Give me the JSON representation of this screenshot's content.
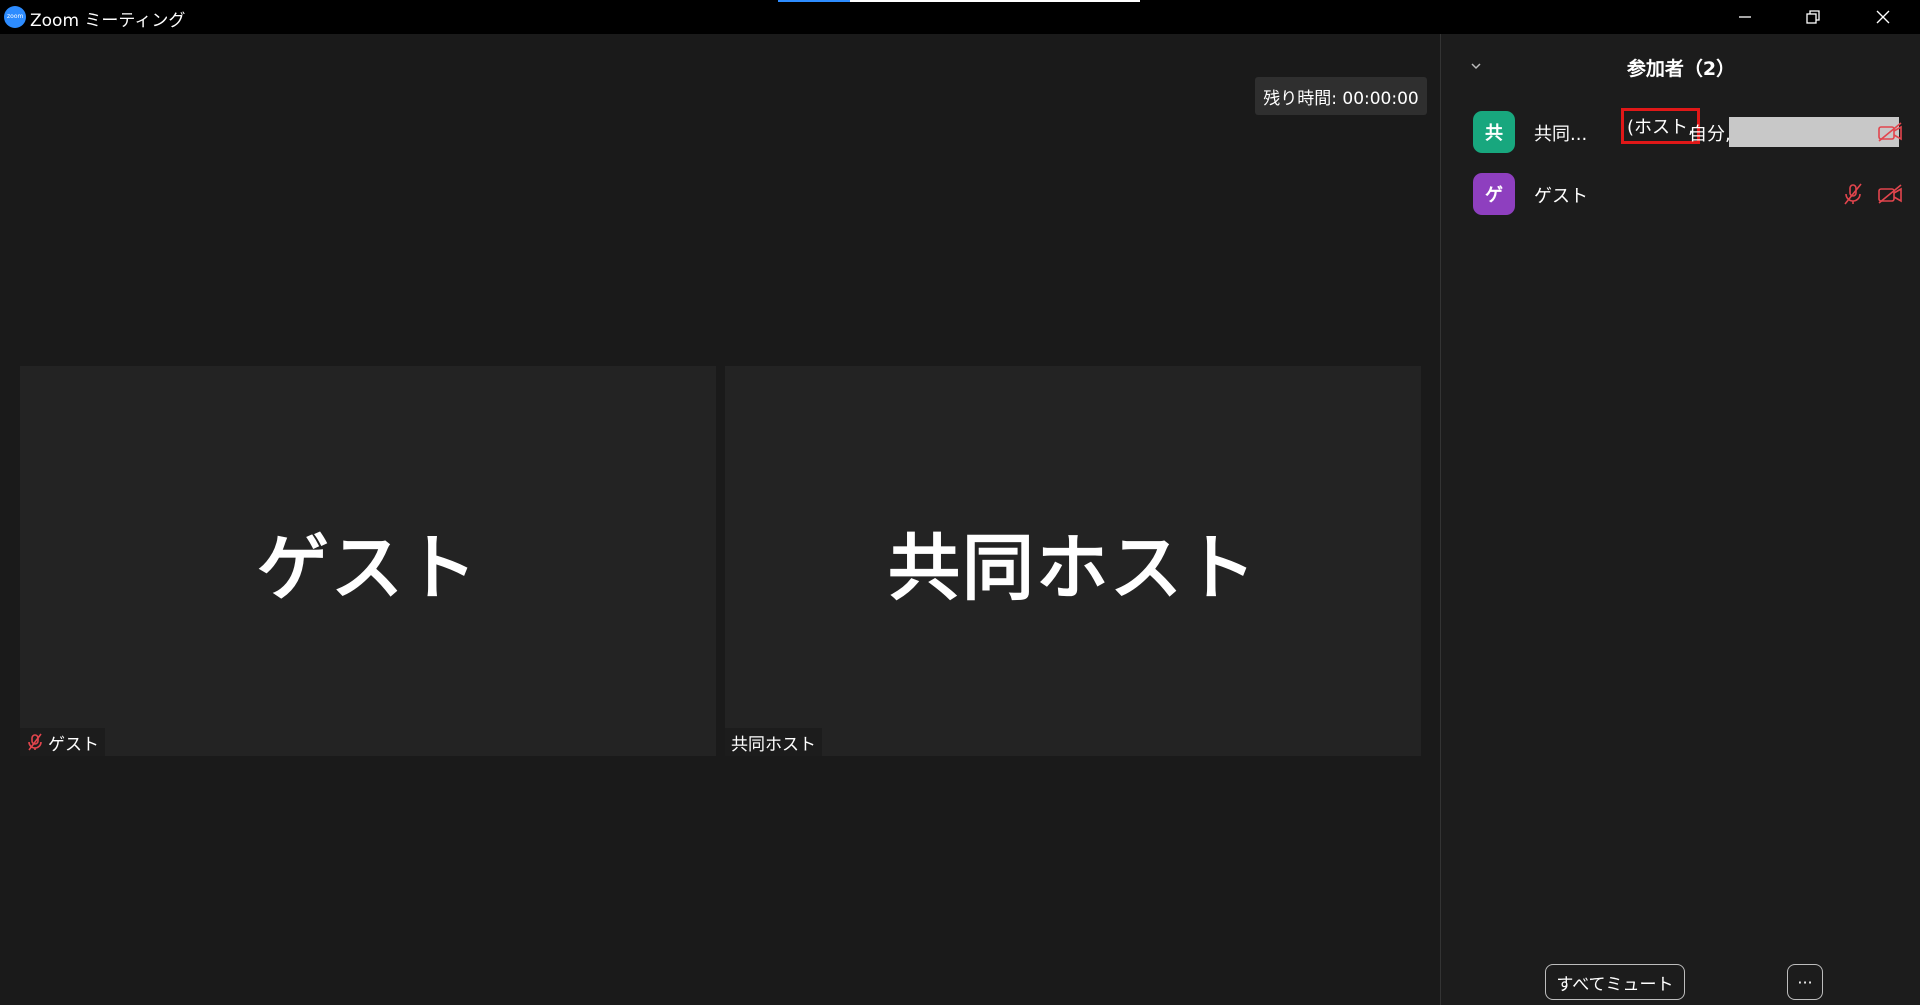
{
  "window": {
    "title": "Zoom ミーティング",
    "load_progress": 0.2
  },
  "meeting": {
    "timer": "残り時間: 00:00:00"
  },
  "tiles": [
    {
      "big_name": "ゲスト",
      "label": "ゲスト",
      "muted": true
    },
    {
      "big_name": "共同ホスト",
      "label": "共同ホスト",
      "muted": false
    }
  ],
  "panel": {
    "title": "参加者（2）",
    "participants": [
      {
        "avatar": "共",
        "avatar_color": "#18a77e",
        "name": "共同...",
        "host_tag": "(ホスト,",
        "self_tag": "自分,",
        "mic_muted": false,
        "video_off": true
      },
      {
        "avatar": "ゲ",
        "avatar_color": "#8e3fbf",
        "name": "ゲスト",
        "mic_muted": true,
        "video_off": true
      }
    ],
    "mute_all_label": "すべてミュート",
    "more_label": "···"
  },
  "colors": {
    "accent": "#2d8cff",
    "muted_icon": "#e2454d",
    "highlight_box": "#e01818"
  }
}
